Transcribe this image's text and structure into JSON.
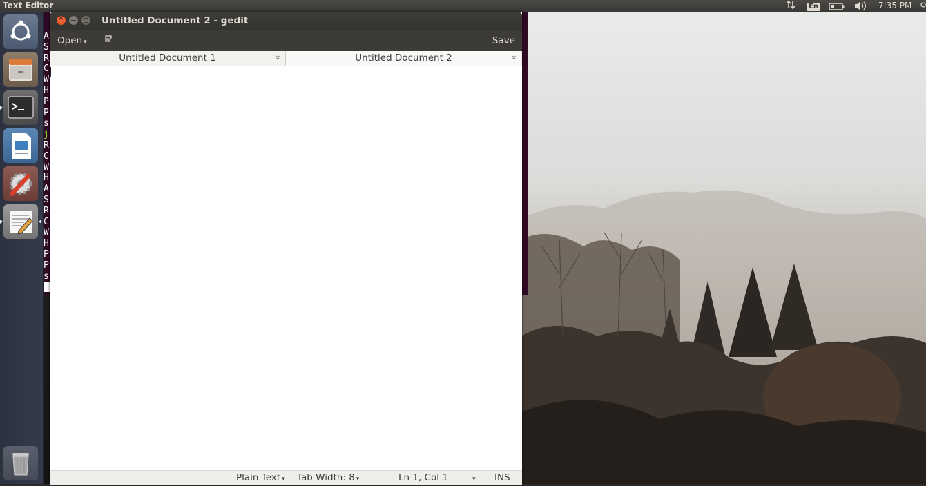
{
  "top_panel": {
    "app_name": "Text Editor",
    "keyboard_layout": "En",
    "clock": "7:35 PM",
    "icons": [
      "network-icon",
      "keyboard-layout-icon",
      "battery-icon",
      "volume-icon",
      "system-menu-icon"
    ]
  },
  "launcher": {
    "items": [
      {
        "name": "dash-home",
        "icon": "ubuntu-logo-icon"
      },
      {
        "name": "files",
        "icon": "file-cabinet-icon"
      },
      {
        "name": "terminal",
        "icon": "terminal-icon"
      },
      {
        "name": "libreoffice-impress",
        "icon": "presentation-icon"
      },
      {
        "name": "system-settings",
        "icon": "settings-wrench-icon"
      },
      {
        "name": "text-editor",
        "icon": "text-editor-icon"
      },
      {
        "name": "trash",
        "icon": "trash-icon"
      }
    ]
  },
  "terminal_behind": {
    "letters": [
      "A",
      "S",
      "R",
      "C",
      "W",
      "H",
      "P",
      "P",
      "s",
      "j",
      "R",
      "C",
      "W",
      "H",
      "A",
      "S",
      "R",
      "C",
      "W",
      "H",
      "P",
      "P",
      "s"
    ]
  },
  "window": {
    "title": "Untitled Document 2 - gedit",
    "toolbar": {
      "open_label": "Open",
      "pin_icon": "pin-icon",
      "save_label": "Save"
    },
    "tabs": [
      {
        "label": "Untitled Document 1",
        "close": "×"
      },
      {
        "label": "Untitled Document 2",
        "close": "×"
      }
    ],
    "status": {
      "language": "Plain Text",
      "tab_width": "Tab Width: 8",
      "position": "Ln 1, Col 1",
      "mode": "INS"
    }
  },
  "colors": {
    "panel": "#3a3935",
    "launcher": "#2d3240",
    "terminal_bg": "#300a24",
    "close_button": "#df4a16"
  }
}
